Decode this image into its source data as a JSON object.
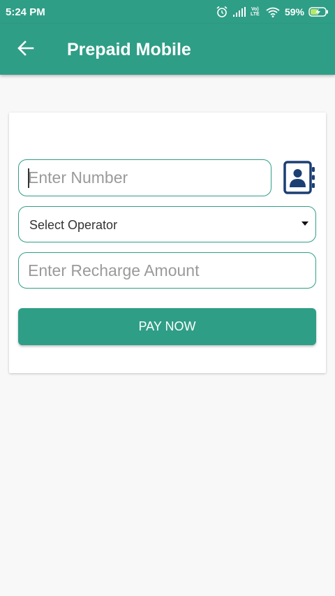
{
  "status_bar": {
    "time": "5:24 PM",
    "battery_percent": "59%",
    "network_badge": [
      "Vo)",
      "LTE"
    ],
    "icons": [
      "alarm-icon",
      "signal-icon",
      "volte-icon",
      "wifi-icon",
      "battery-charging-icon"
    ]
  },
  "app_bar": {
    "back_icon": "arrow-left-icon",
    "title": "Prepaid Mobile"
  },
  "form": {
    "number_placeholder": "Enter Number",
    "contacts_icon": "contacts-book-icon",
    "operator_selected": "Select Operator",
    "amount_placeholder": "Enter Recharge Amount",
    "pay_label": "PAY NOW"
  },
  "colors": {
    "primary": "#2f9e86",
    "contacts_icon": "#1c3f73",
    "background": "#f8f8f8"
  }
}
